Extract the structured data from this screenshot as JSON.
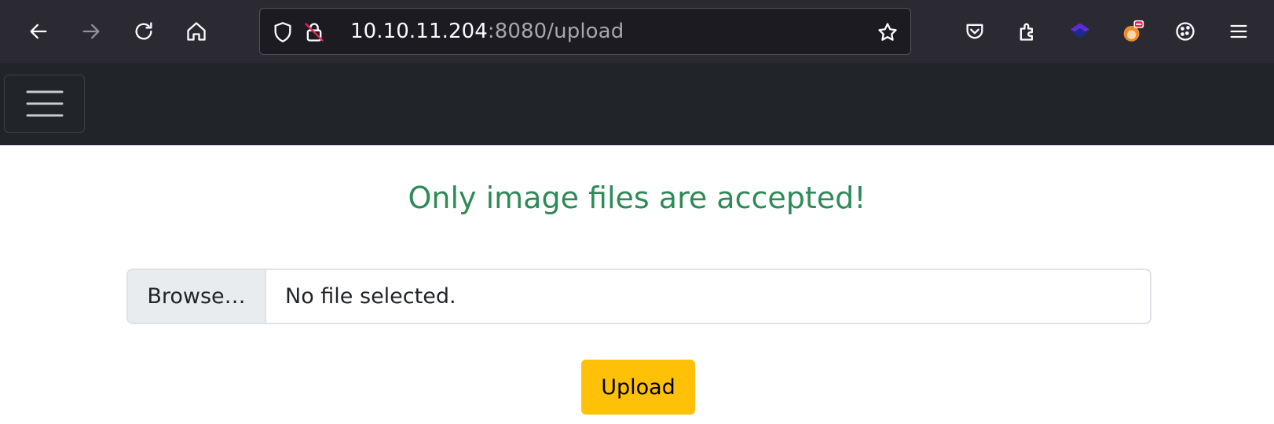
{
  "browser": {
    "url_host": "10.10.11.204",
    "url_rest": ":8080/upload",
    "icons": {
      "back": "arrow-left-icon",
      "forward": "arrow-right-icon",
      "reload": "reload-icon",
      "home": "home-icon",
      "tracking": "shield-icon",
      "insecure": "insecure-lock-icon",
      "bookmark": "star-icon",
      "pocket": "pocket-icon",
      "extensions": "puzzle-icon",
      "extension_layers": "layers-icon",
      "extension_fox": "foxyproxy-icon",
      "cookie": "cookie-icon",
      "menu": "hamburger-menu-icon"
    }
  },
  "navbar": {
    "toggler_icon": "hamburger-menu-icon"
  },
  "upload_page": {
    "message": "Only image files are accepted!",
    "browse_label": "Browse…",
    "file_status": "No file selected.",
    "upload_label": "Upload"
  },
  "colors": {
    "browser_bg": "#2b2a33",
    "navbar_bg": "#212529",
    "message_green": "#2e8b57",
    "upload_yellow": "#ffc107"
  }
}
